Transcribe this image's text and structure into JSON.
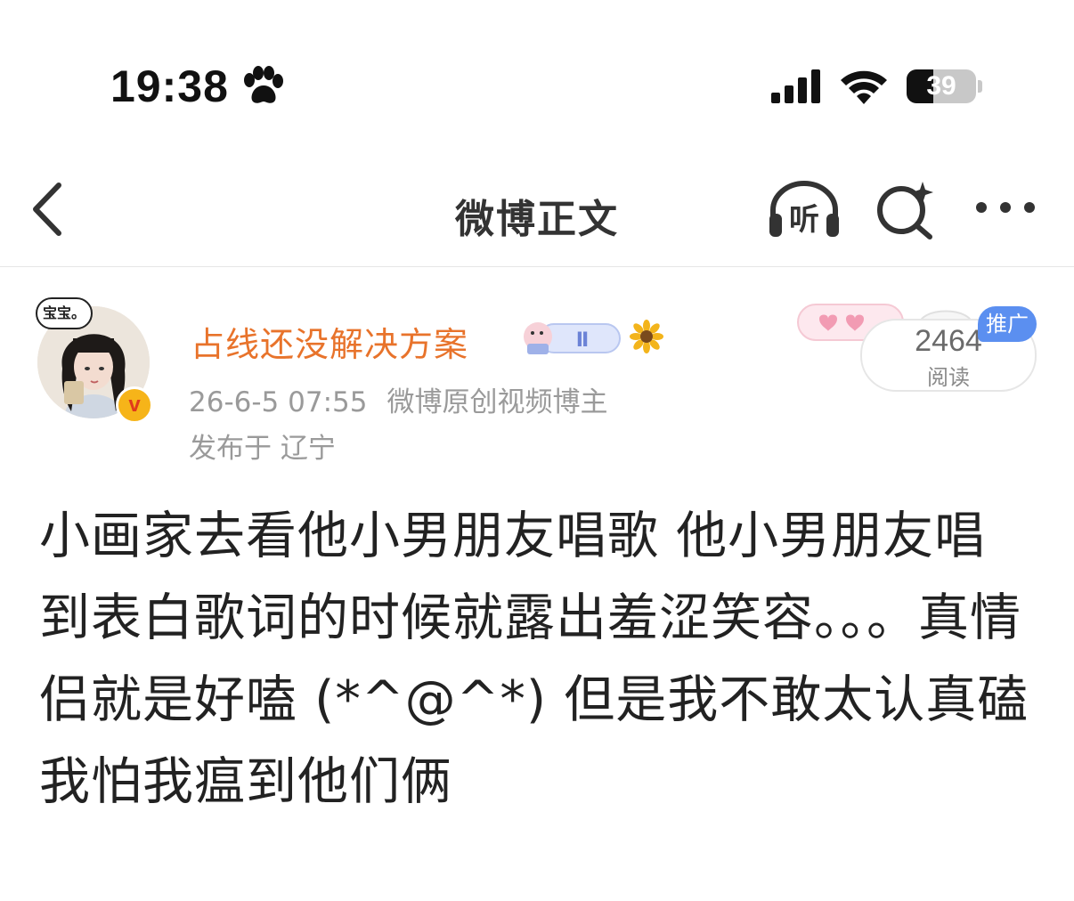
{
  "status_bar": {
    "time": "19:38",
    "battery_level": "39",
    "battery_fraction": 0.39
  },
  "nav": {
    "title": "微博正文",
    "listen_label": "听"
  },
  "post": {
    "avatar_badge": "宝宝。",
    "username": "占线还没解决方案",
    "level_badge": "Ⅱ",
    "timestamp": "26-6-5 07:55",
    "author_tag": "微博原创视频博主",
    "location": "发布于 辽宁",
    "read_count": "2464",
    "read_label": "阅读",
    "promo_tag": "推广",
    "text": "小画家去看他小男朋友唱歌 他小男朋友唱到表白歌词的时候就露出羞涩笑容。。。真情侣就是好嗑 (*^@^*) 但是我不敢太认真磕我怕我瘟到他们俩"
  },
  "colors": {
    "username": "#e8732b",
    "meta": "#9a9a9a",
    "promo": "#5b8ff0"
  },
  "icons": [
    "paw-icon",
    "signal-icon",
    "wifi-icon",
    "battery-icon",
    "back-icon",
    "listen-headphones-icon",
    "search-sparkle-icon",
    "more-icon",
    "verified-icon",
    "sunflower-icon"
  ]
}
